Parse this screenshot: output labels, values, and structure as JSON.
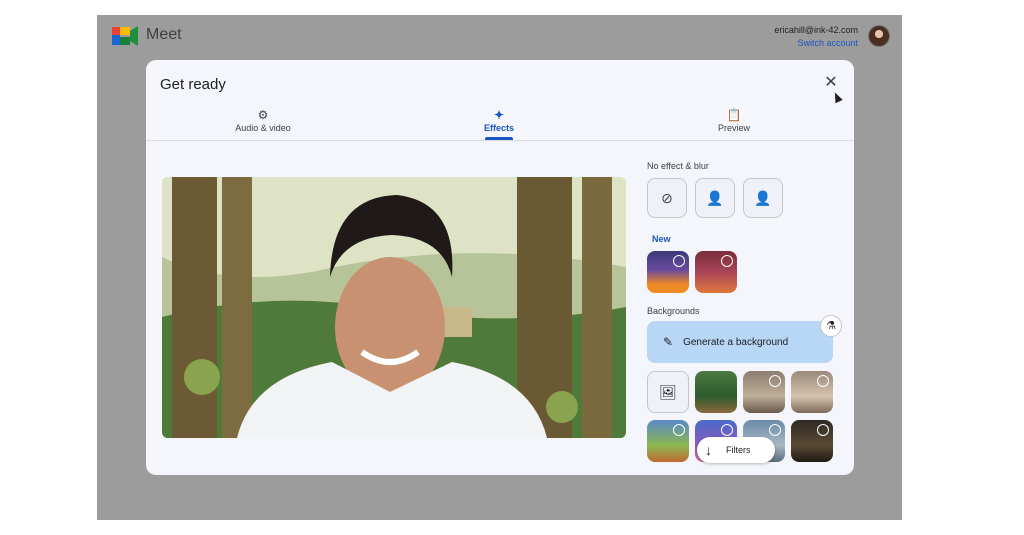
{
  "app": {
    "name": "Meet",
    "logo_icon": "google-meet-logo"
  },
  "account": {
    "email": "ericahill@ink-42.com",
    "switch_label": "Switch account"
  },
  "dialog": {
    "title": "Get ready",
    "close_icon": "close-icon",
    "tabs": [
      {
        "label": "Audio & video",
        "icon": "settings-sparkle-icon",
        "active": false
      },
      {
        "label": "Effects",
        "icon": "sparkle-icon",
        "active": true
      },
      {
        "label": "Preview",
        "icon": "clipboard-check-icon",
        "active": false
      }
    ]
  },
  "effects": {
    "no_effect_label": "No effect & blur",
    "no_effect_buttons": [
      "no-effect-icon",
      "slight-blur-icon",
      "full-blur-icon"
    ],
    "new_label": "New",
    "new_thumbnails": [
      "halloween-pumpkins",
      "halloween-magic"
    ],
    "backgrounds_label": "Backgrounds",
    "generate_label": "Generate a background",
    "filters_label": "Filters"
  },
  "colors": {
    "accent": "#1a56c4",
    "generate_bg": "#b8d6f6",
    "screen_bg": "#9c9c9c"
  }
}
